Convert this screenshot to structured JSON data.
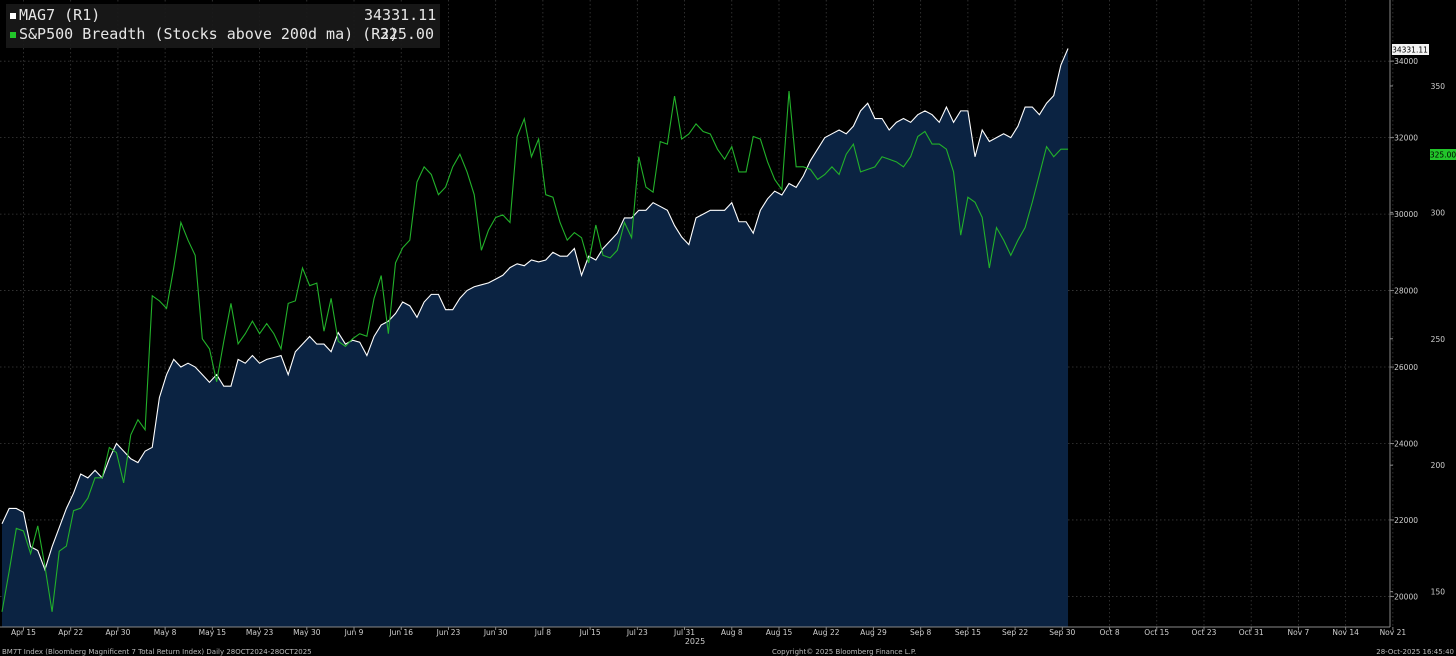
{
  "legend": {
    "series1_label": "MAG7 (R1)",
    "series1_value": "34331.11",
    "series2_label": "S&P500 Breadth (Stocks above 200d ma) (R2)",
    "series2_value": "325.00"
  },
  "footer": {
    "left": "BM7T Index (Bloomberg Magnificent 7 Total Return Index) Daily 28OCT2024-28OCT2025",
    "center": "Copyright© 2025 Bloomberg Finance L.P.",
    "right": "28-Oct-2025 16:45:40"
  },
  "chart_data": {
    "type": "area",
    "x_axis": {
      "tick_labels": [
        "Apr 15",
        "Apr 22",
        "Apr 30",
        "May 8",
        "May 15",
        "May 23",
        "May 30",
        "Jun 9",
        "Jun 16",
        "Jun 23",
        "Jun 30",
        "Jul 8",
        "Jul 15",
        "Jul 23",
        "Jul 31",
        "Aug 8",
        "Aug 15",
        "Aug 22",
        "Aug 29",
        "Sep 8",
        "Sep 15",
        "Sep 22",
        "Sep 30",
        "Oct 8",
        "Oct 15",
        "Oct 23",
        "Oct 31",
        "Nov 7",
        "Nov 14",
        "Nov 21"
      ],
      "year_label": "2025",
      "n_points": 161,
      "total_slots": 195
    },
    "axis_r1": {
      "ticks": [
        20000,
        22000,
        24000,
        26000,
        28000,
        30000,
        32000,
        34000
      ],
      "range": [
        19200,
        35600
      ],
      "last_value_label": "34331.11"
    },
    "axis_r2": {
      "ticks": [
        150,
        200,
        250,
        300,
        350
      ],
      "range": [
        136,
        384
      ],
      "last_value_label": "325.00"
    },
    "grid": true,
    "legend_position": "top-left",
    "colors": {
      "mag7_line": "#ffffff",
      "mag7_fill": "#0b2342",
      "breadth_line": "#22b12a",
      "background": "#000000",
      "grid": "#3a3a3a",
      "last_r2_tag": "#22c52a"
    },
    "series": [
      {
        "name": "MAG7 (R1)",
        "axis": "R1",
        "values": [
          21900,
          22300,
          22300,
          22200,
          21300,
          21200,
          20700,
          21300,
          21800,
          22300,
          22700,
          23200,
          23100,
          23300,
          23100,
          23600,
          24000,
          23800,
          23600,
          23500,
          23800,
          23900,
          25200,
          25800,
          26200,
          26000,
          26100,
          26000,
          25800,
          25600,
          25800,
          25500,
          25500,
          26200,
          26100,
          26300,
          26100,
          26200,
          26250,
          26300,
          25800,
          26400,
          26600,
          26800,
          26600,
          26600,
          26400,
          26900,
          26600,
          26700,
          26650,
          26300,
          26800,
          27100,
          27200,
          27400,
          27700,
          27600,
          27300,
          27700,
          27900,
          27900,
          27500,
          27500,
          27800,
          28000,
          28100,
          28150,
          28200,
          28300,
          28400,
          28600,
          28700,
          28650,
          28800,
          28750,
          28800,
          29000,
          28900,
          28900,
          29100,
          28400,
          28900,
          28800,
          29100,
          29300,
          29500,
          29900,
          29900,
          30100,
          30100,
          30300,
          30200,
          30100,
          29700,
          29400,
          29200,
          29900,
          30000,
          30100,
          30100,
          30100,
          30300,
          29800,
          29800,
          29500,
          30100,
          30400,
          30600,
          30500,
          30800,
          30700,
          31000,
          31400,
          31700,
          32000,
          32100,
          32200,
          32100,
          32300,
          32700,
          32900,
          32500,
          32500,
          32200,
          32400,
          32500,
          32400,
          32600,
          32700,
          32600,
          32400,
          32800,
          32400,
          32700,
          32700,
          31500,
          32200,
          31900,
          32000,
          32100,
          32000,
          32300,
          32800,
          32800,
          32600,
          32900,
          33100,
          33900,
          34331.11
        ]
      },
      {
        "name": "S&P500 Breadth (Stocks above 200d ma) (R2)",
        "axis": "R2",
        "values": [
          142,
          158,
          175,
          174,
          165,
          176,
          160,
          142,
          166,
          168,
          182,
          183,
          187,
          195,
          195,
          207,
          205,
          193,
          212,
          218,
          214,
          267,
          265,
          262,
          278,
          296,
          289,
          283,
          250,
          246,
          233,
          249,
          264,
          248,
          252,
          257,
          252,
          256,
          252,
          246,
          264,
          265,
          278,
          271,
          272,
          253,
          266,
          249,
          247,
          250,
          252,
          251,
          266,
          275,
          252,
          280,
          286,
          289,
          312,
          318,
          315,
          307,
          310,
          318,
          323,
          316,
          307,
          285,
          293,
          298,
          299,
          296,
          330,
          337,
          322,
          329,
          307,
          306,
          296,
          289,
          292,
          290,
          280,
          295,
          283,
          282,
          285,
          296,
          290,
          322,
          310,
          308,
          328,
          327,
          346,
          329,
          331,
          335,
          332,
          331,
          325,
          321,
          326,
          316,
          316,
          330,
          329,
          320,
          313,
          309,
          348,
          318,
          318,
          317,
          313,
          315,
          318,
          315,
          323,
          327,
          316,
          317,
          318,
          322,
          321,
          320,
          318,
          322,
          330,
          332,
          327,
          327,
          325,
          316,
          291,
          306,
          304,
          298,
          278,
          294,
          289,
          283,
          289,
          294,
          304,
          315,
          326,
          322,
          325,
          325
        ]
      }
    ]
  }
}
